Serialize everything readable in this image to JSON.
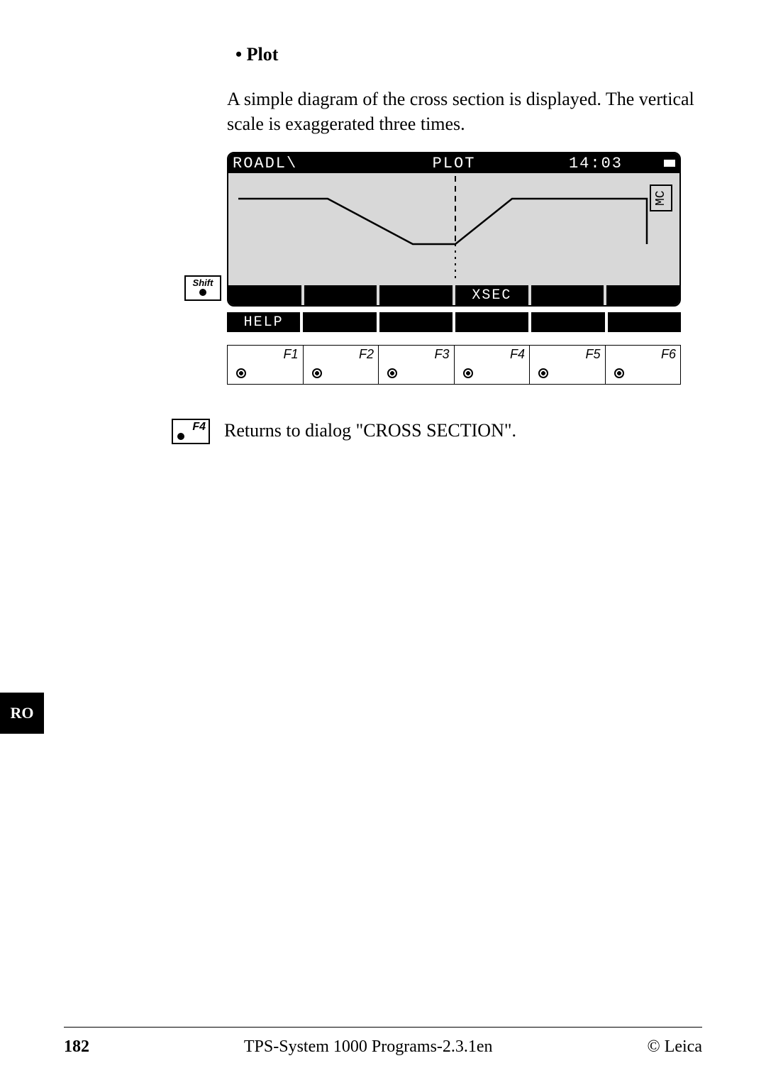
{
  "heading": "Plot",
  "paragraph": "A simple diagram of the cross section is displayed. The vertical scale is exaggerated three times.",
  "screen": {
    "title_left": "ROADL\\",
    "title_center": "PLOT",
    "title_right": "14:03",
    "mc_badge": "MC",
    "softkeys_row1": [
      "",
      "",
      "",
      "XSEC",
      "",
      ""
    ],
    "softkeys_row2": [
      "HELP",
      "",
      "",
      "",
      "",
      ""
    ]
  },
  "shift_label": "Shift",
  "fkeys": [
    "F1",
    "F2",
    "F3",
    "F4",
    "F5",
    "F6"
  ],
  "footnote": {
    "key": "F4",
    "text": "Returns to dialog \"CROSS SECTION\"."
  },
  "side_tab": "RO",
  "footer": {
    "page": "182",
    "center": "TPS-System 1000 Programs-2.3.1en",
    "right": "© Leica"
  }
}
